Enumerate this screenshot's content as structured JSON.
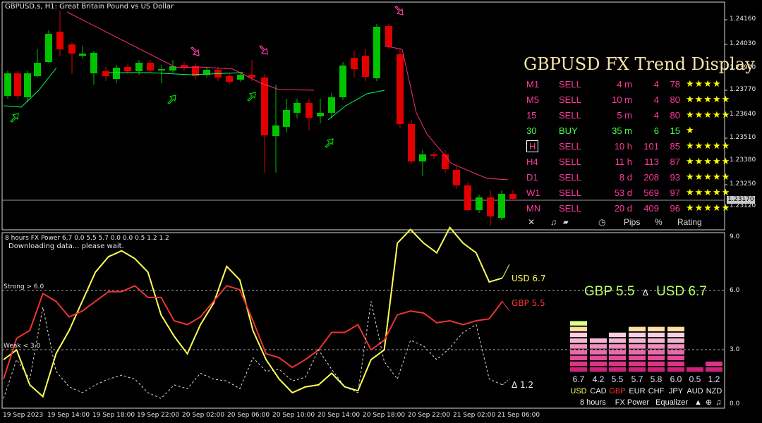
{
  "main_chart": {
    "title": "GBPUSD.s, H1:  Great Britain Pound vs US Dollar",
    "price_ticks": [
      "1.24160",
      "1.24030",
      "1.23900",
      "1.23770",
      "1.23640",
      "1.23510",
      "1.23380",
      "1.23250",
      "1.23120"
    ],
    "current_price": "1.23170"
  },
  "trend_display": {
    "title": "GBPUSD FX Trend Display",
    "rows": [
      {
        "tf": "M1",
        "signal": "SELL",
        "dur": "4 m",
        "pips": "4",
        "pct": "78",
        "rating": "★★★★"
      },
      {
        "tf": "M5",
        "signal": "SELL",
        "dur": "10 m",
        "pips": "4",
        "pct": "80",
        "rating": "★★★★★"
      },
      {
        "tf": "15",
        "signal": "SELL",
        "dur": "5 m",
        "pips": "4",
        "pct": "80",
        "rating": "★★★★★"
      },
      {
        "tf": "30",
        "signal": "BUY",
        "dur": "35 m",
        "pips": "6",
        "pct": "15",
        "rating": "★"
      },
      {
        "tf": "H",
        "signal": "SELL",
        "dur": "10 h",
        "pips": "101",
        "pct": "85",
        "rating": "★★★★★"
      },
      {
        "tf": "H4",
        "signal": "SELL",
        "dur": "11 h",
        "pips": "113",
        "pct": "87",
        "rating": "★★★★★"
      },
      {
        "tf": "D1",
        "signal": "SELL",
        "dur": "8 d",
        "pips": "208",
        "pct": "93",
        "rating": "★★★★★"
      },
      {
        "tf": "W1",
        "signal": "SELL",
        "dur": "53 d",
        "pips": "569",
        "pct": "97",
        "rating": "★★★★★"
      },
      {
        "tf": "MN",
        "signal": "SELL",
        "dur": "20 d",
        "pips": "409",
        "pct": "96",
        "rating": "★★★★★"
      }
    ],
    "footer": {
      "close": "✕",
      "music": "♫",
      "clock": "◷",
      "pips": "Pips",
      "pct": "%",
      "rating": "Rating"
    }
  },
  "power_chart": {
    "title": "8 hours FX Power 6.7 0.0 5.5 5.7 0.0 0.0 0.5 1.2 1.2",
    "status": "Downloading data... please wait.",
    "strong_label": "Strong > 6.0",
    "weak_label": "Weak < 3.0",
    "y_ticks": [
      "9.0",
      "6.0",
      "3.0",
      "0.0"
    ],
    "usd_label": "USD 6.7",
    "gbp_label": "GBP 5.5",
    "delta_label": "Δ 1.2",
    "summary": {
      "gbp": "GBP 5.5",
      "delta": "Δ",
      "usd": "USD 6.7"
    },
    "chart_data": {
      "type": "line",
      "ylim": [
        0,
        9
      ],
      "series": [
        {
          "name": "USD",
          "color": "#ffff55",
          "values": [
            2.5,
            3.0,
            1.2,
            0.6,
            2.8,
            4.0,
            5.5,
            7.0,
            7.8,
            8.1,
            7.7,
            7.0,
            4.8,
            3.7,
            2.8,
            4.3,
            5.4,
            7.3,
            6.6,
            4.0,
            2.5,
            1.5,
            0.8,
            1.1,
            1.2,
            1.8,
            1.1,
            0.9,
            2.5,
            3.0,
            8.5,
            9.2,
            8.5,
            8.0,
            9.3,
            8.5,
            8.0,
            6.5,
            6.7
          ]
        },
        {
          "name": "GBP",
          "color": "#ee3333",
          "values": [
            1.5,
            3.6,
            4.0,
            5.9,
            5.5,
            4.7,
            5.0,
            5.5,
            6.0,
            6.0,
            6.3,
            5.7,
            5.7,
            4.5,
            4.3,
            4.7,
            5.5,
            6.3,
            6.1,
            4.5,
            2.8,
            2.6,
            2.1,
            2.5,
            3.0,
            3.9,
            3.9,
            4.3,
            3.0,
            3.5,
            4.8,
            5.0,
            4.9,
            4.4,
            4.5,
            4.3,
            4.5,
            4.6,
            5.5
          ]
        },
        {
          "name": "Δ",
          "color": "#dddddd",
          "dashed": true,
          "values": [
            0.5,
            2.5,
            1.5,
            5.2,
            1.9,
            1.1,
            0.8,
            1.2,
            1.5,
            1.7,
            1.5,
            0.8,
            0.5,
            1.2,
            1.0,
            1.8,
            1.5,
            1.4,
            1.0,
            2.6,
            1.9,
            2.0,
            1.4,
            1.6,
            3.0,
            2.0,
            1.1,
            0.8,
            5.5,
            2.4,
            1.5,
            3.5,
            3.2,
            2.5,
            3.1,
            3.9,
            4.3,
            1.5,
            1.2
          ]
        }
      ],
      "strong_level": 6.0,
      "weak_level": 3.0
    },
    "time_labels": [
      "19 Sep 2023",
      "19 Sep 14:00",
      "19 Sep 18:00",
      "19 Sep 22:00",
      "20 Sep 02:00",
      "20 Sep 06:00",
      "20 Sep 10:00",
      "20 Sep 14:00",
      "20 Sep 18:00",
      "20 Sep 22:00",
      "21 Sep 02:00",
      "21 Sep 06:00"
    ]
  },
  "equalizer": {
    "values": [
      "6.7",
      "4.2",
      "5.5",
      "5.7",
      "5.8",
      "6.0",
      "0.5",
      "1.2"
    ],
    "currencies": [
      "USD",
      "CAD",
      "GBP",
      "EUR",
      "CHF",
      "JPY",
      "AUD",
      "NZD"
    ],
    "levels": [
      6.7,
      4.2,
      5.5,
      5.7,
      5.8,
      6.0,
      0.5,
      1.2
    ],
    "footer": {
      "period": "8 hours",
      "power": "FX Power",
      "equalizer": "Equalizer"
    },
    "colors": {
      "usd": "#ffff66",
      "gbp": "#ff3333",
      "other": "#f0f0f0"
    }
  }
}
